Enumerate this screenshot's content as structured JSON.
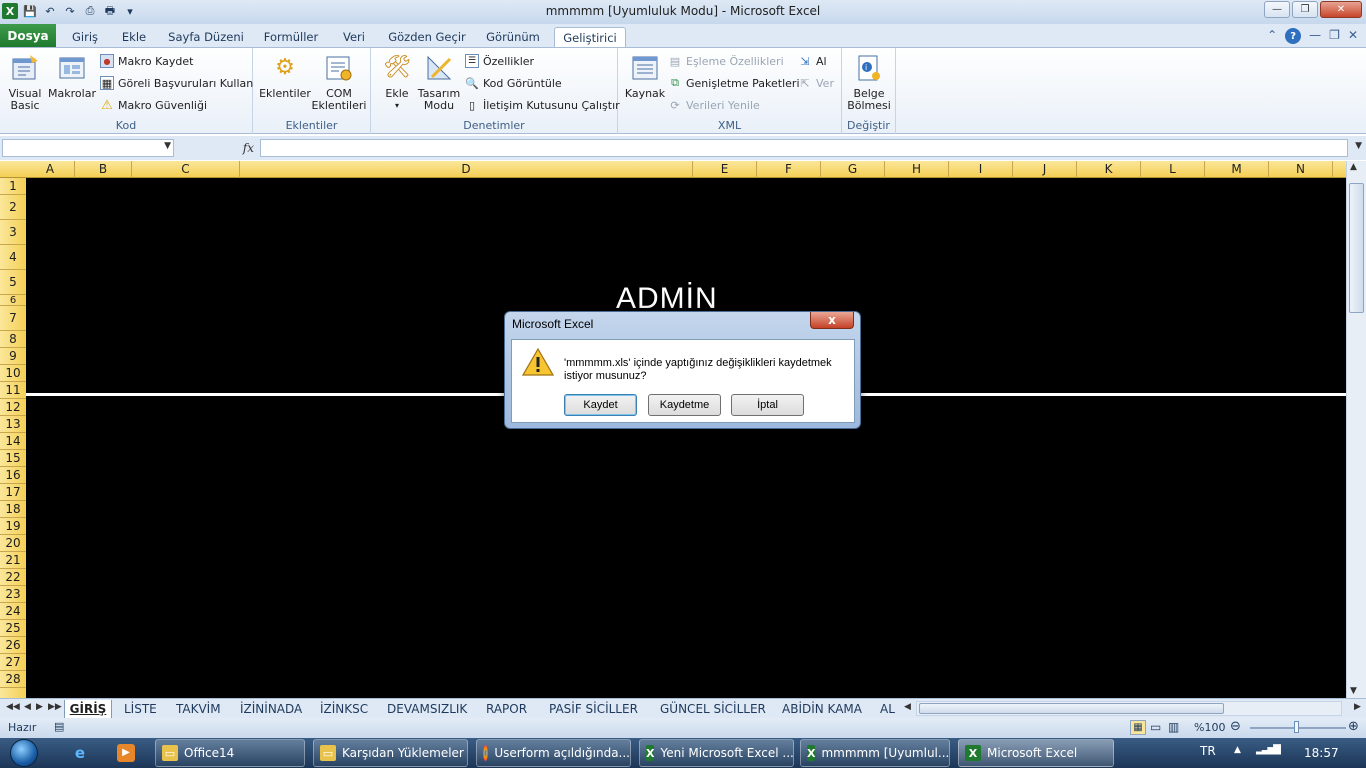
{
  "window": {
    "title": "mmmmm  [Uyumluluk Modu]  -  Microsoft Excel"
  },
  "ribbon_tabs": {
    "file": "Dosya",
    "tabs": [
      "Giriş",
      "Ekle",
      "Sayfa Düzeni",
      "Formüller",
      "Veri",
      "Gözden Geçir",
      "Görünüm",
      "Geliştirici"
    ],
    "active": "Geliştirici"
  },
  "ribbon": {
    "kod": {
      "label": "Kod",
      "visual_basic": "Visual Basic",
      "makrolar": "Makrolar",
      "makro_kaydet": "Makro Kaydet",
      "goreli": "Göreli Başvuruları Kullan",
      "makro_guvenligi": "Makro Güvenliği"
    },
    "eklentiler": {
      "label": "Eklentiler",
      "eklentiler_btn": "Eklentiler",
      "com": "COM Eklentileri"
    },
    "denetimler": {
      "label": "Denetimler",
      "ekle": "Ekle",
      "tasarim": "Tasarım Modu",
      "ozellikler": "Özellikler",
      "kod_goruntule": "Kod Görüntüle",
      "iletisim": "İletişim Kutusunu Çalıştır"
    },
    "xml": {
      "label": "XML",
      "kaynak": "Kaynak",
      "esleme": "Eşleme Özellikleri",
      "genisletme": "Genişletme Paketleri",
      "verileri_yenile": "Verileri Yenile",
      "al": "Al",
      "ver": "Ver"
    },
    "degistir": {
      "label": "Değiştir",
      "belge": "Belge Bölmesi"
    }
  },
  "formula_bar": {
    "name_box": "",
    "fx": "fx",
    "formula": ""
  },
  "columns": [
    "A",
    "B",
    "C",
    "D",
    "E",
    "F",
    "G",
    "H",
    "I",
    "J",
    "K",
    "L",
    "M",
    "N"
  ],
  "rows": [
    "1",
    "2",
    "3",
    "4",
    "5",
    "6",
    "7",
    "8",
    "9",
    "10",
    "11",
    "12",
    "13",
    "14",
    "15",
    "16",
    "17",
    "18",
    "19",
    "20",
    "21",
    "22",
    "23",
    "24",
    "25",
    "26",
    "27",
    "28"
  ],
  "sheet_content": {
    "heading": "ADMİN"
  },
  "sheet_tabs": {
    "tabs": [
      "GİRİŞ",
      "LİSTE",
      "TAKVİM",
      "İZİNİNADA",
      "İZİNKSC",
      "DEVAMSIZLIK",
      "RAPOR",
      "PASİF SİCİLLER",
      "GÜNCEL SİCİLLER",
      "ABİDİN KAMA",
      "AL"
    ],
    "active": "GİRİŞ"
  },
  "status_bar": {
    "ready": "Hazır",
    "zoom": "%100"
  },
  "dialog": {
    "title": "Microsoft Excel",
    "close": "x",
    "message": "'mmmmm.xls' içinde yaptığınız değişiklikleri kaydetmek istiyor musunuz?",
    "buttons": [
      "Kaydet",
      "Kaydetme",
      "İptal"
    ]
  },
  "taskbar": {
    "items": [
      "Office14",
      "Karşıdan Yüklemeler",
      "Userform açıldığında...",
      "Yeni Microsoft Excel ...",
      "mmmmm  [Uyumlul...",
      "Microsoft Excel"
    ],
    "lang": "TR",
    "clock": "18:57"
  },
  "colors": {
    "sheet_bg": "#000000",
    "header_active": "#f4cf55",
    "file_tab": "#2a8a3a"
  }
}
